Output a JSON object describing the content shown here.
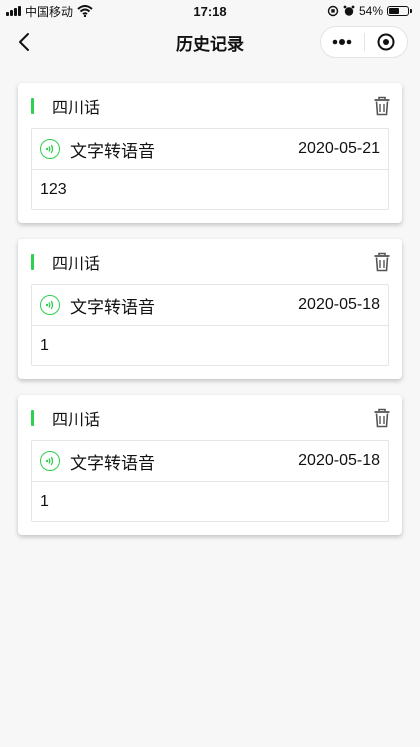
{
  "status_bar": {
    "carrier": "中国移动",
    "time": "17:18",
    "battery_percent": "54%",
    "battery_level": 0.54
  },
  "nav": {
    "title": "历史记录"
  },
  "colors": {
    "accent": "#2fcf4f"
  },
  "icons": {
    "back": "chevron-left-icon",
    "more": "more-dots-icon",
    "close": "target-circle-icon",
    "delete": "trash-icon",
    "audio": "audio-wave-icon"
  },
  "records": [
    {
      "title": "四川话",
      "type_label": "文字转语音",
      "date": "2020-05-21",
      "content": "123"
    },
    {
      "title": "四川话",
      "type_label": "文字转语音",
      "date": "2020-05-18",
      "content": "1"
    },
    {
      "title": "四川话",
      "type_label": "文字转语音",
      "date": "2020-05-18",
      "content": "1"
    }
  ]
}
